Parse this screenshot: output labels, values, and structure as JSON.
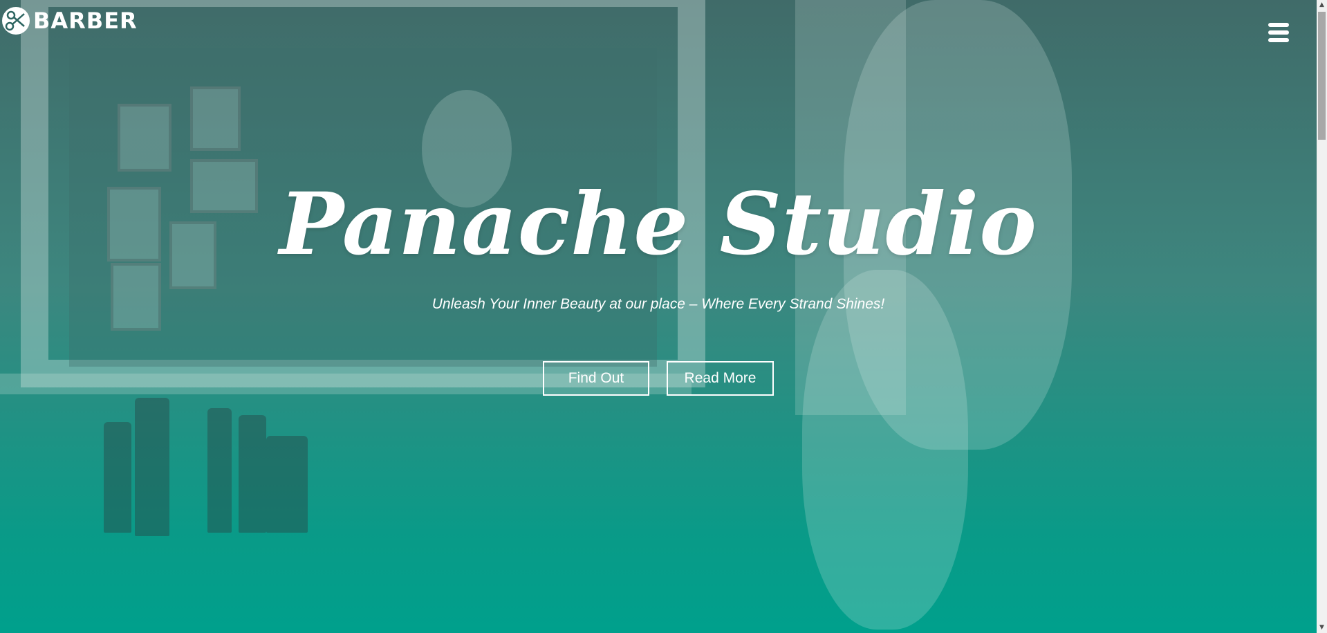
{
  "brand": {
    "name": "BARBER",
    "logo_icon": "scissors-comb-logo-icon"
  },
  "nav": {
    "menu_icon": "hamburger-menu-icon"
  },
  "hero": {
    "title": "Panache Studio",
    "subtitle": "Unleash Your Inner Beauty at our place – Where Every Strand Shines!",
    "buttons": {
      "find_out": "Find Out",
      "read_more": "Read More"
    },
    "overlay_color_top": "#1d4f4c",
    "overlay_color_bottom": "#00a08c"
  },
  "scrollbar": {
    "up_arrow": "▲",
    "down_arrow": "▼"
  }
}
